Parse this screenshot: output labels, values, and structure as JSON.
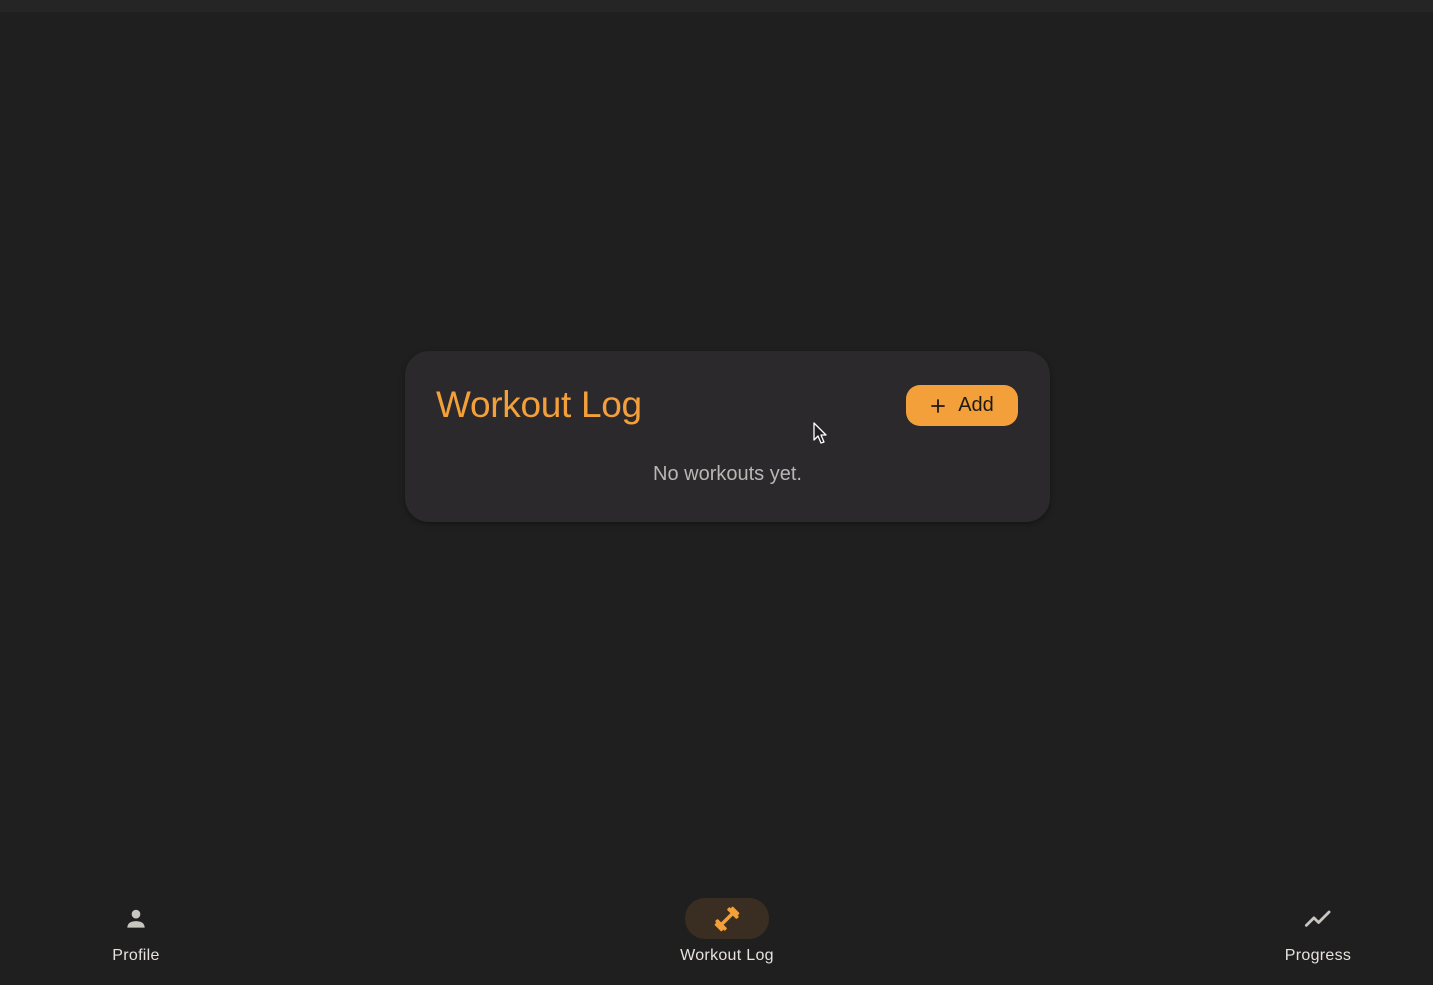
{
  "card": {
    "title": "Workout Log",
    "add_label": "Add",
    "add_icon": "plus-icon",
    "empty_message": "No workouts yet."
  },
  "nav": {
    "items": [
      {
        "label": "Profile",
        "icon": "person-icon",
        "active": false
      },
      {
        "label": "Workout Log",
        "icon": "dumbbell-icon",
        "active": true
      },
      {
        "label": "Progress",
        "icon": "trending-up-icon",
        "active": false
      }
    ]
  },
  "colors": {
    "accent": "#f4a03a",
    "background": "#1f1f1f",
    "card": "#2b292c",
    "active_indicator": "#3a2e23"
  }
}
